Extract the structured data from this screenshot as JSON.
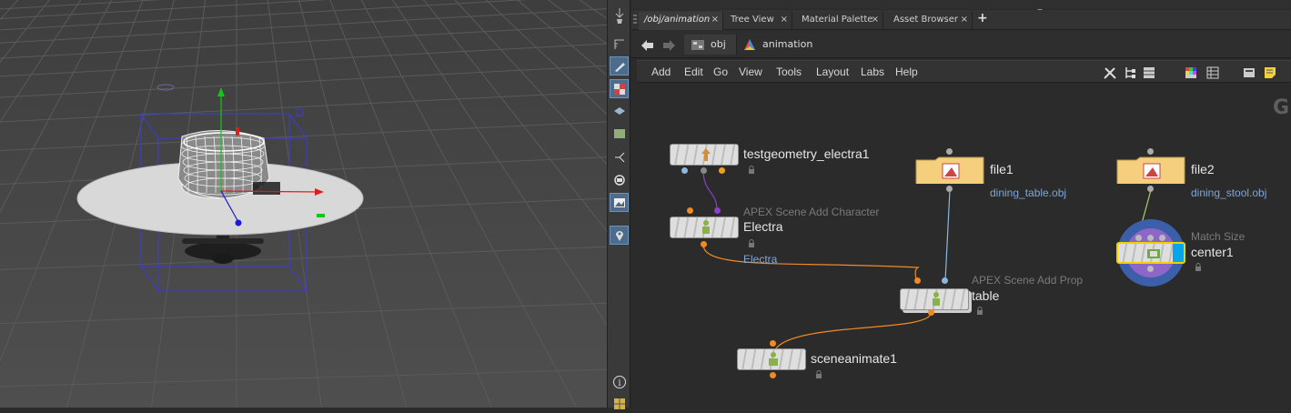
{
  "tabs": [
    {
      "label": "/obj/animation",
      "active": true
    },
    {
      "label": "Tree View",
      "active": false
    },
    {
      "label": "Material Palette",
      "active": false
    },
    {
      "label": "Asset Browser",
      "active": false
    }
  ],
  "tab_close": "×",
  "add_tab": "+",
  "path": {
    "level1": "obj",
    "level2": "animation"
  },
  "menu": [
    "Add",
    "Edit",
    "Go",
    "View",
    "Tools",
    "Layout",
    "Labs",
    "Help"
  ],
  "network_letter": "G",
  "nodes": {
    "testgeometry": {
      "name": "testgeometry_electra1"
    },
    "electra": {
      "type": "APEX Scene Add Character",
      "name": "Electra",
      "sub": "Electra"
    },
    "file1": {
      "name": "file1",
      "sub": "dining_table.obj"
    },
    "file2": {
      "name": "file2",
      "sub": "dining_stool.obj"
    },
    "center1": {
      "type": "Match Size",
      "name": "center1"
    },
    "table": {
      "type": "APEX Scene Add Prop",
      "name": "table"
    },
    "sceneanimate": {
      "name": "sceneanimate1"
    }
  },
  "colors": {
    "accent": "#4d6b8a",
    "wire_orange": "#f08a24",
    "wire_blue": "#8ab8e0",
    "wire_purple": "#8a3fd1",
    "file_node": "#f5cf7d",
    "selected": "#f0d000"
  },
  "info_icon": "i"
}
